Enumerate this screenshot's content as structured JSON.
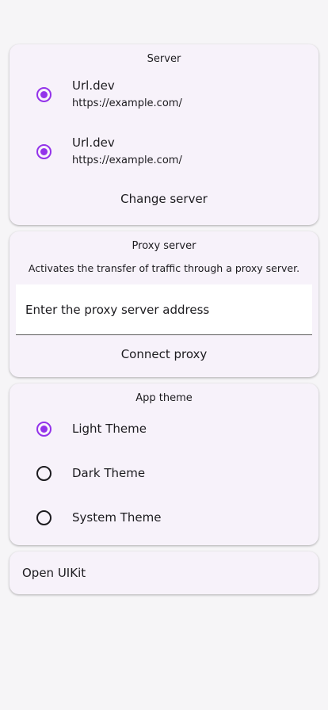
{
  "server_card": {
    "title": "Server",
    "options": [
      {
        "title": "Url.dev",
        "subtitle": "https://example.com/",
        "selected": true
      },
      {
        "title": "Url.dev",
        "subtitle": "https://example.com/",
        "selected": true
      }
    ],
    "change_label": "Change server"
  },
  "proxy_card": {
    "title": "Proxy server",
    "description": "Activates the transfer of traffic through a proxy server.",
    "input_value": "",
    "input_placeholder": "Enter the proxy server address",
    "connect_label": "Connect proxy"
  },
  "theme_card": {
    "title": "App theme",
    "options": [
      {
        "label": "Light Theme",
        "selected": true
      },
      {
        "label": "Dark Theme",
        "selected": false
      },
      {
        "label": "System Theme",
        "selected": false
      }
    ]
  },
  "uikit_card": {
    "label": "Open UIKit"
  },
  "colors": {
    "accent": "#9333ea",
    "card_background": "#f7f2fa",
    "page_background": "#f6f5f7"
  }
}
